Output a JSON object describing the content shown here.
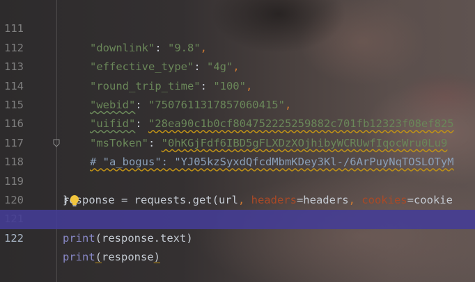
{
  "editor": {
    "lines": [
      {
        "num": "111",
        "key": "\"downlink\"",
        "colon": ": ",
        "value": "\"9.8\"",
        "comma": ","
      },
      {
        "num": "112",
        "key": "\"effective_type\"",
        "colon": ": ",
        "value": "\"4g\"",
        "comma": ","
      },
      {
        "num": "113",
        "key": "\"round_trip_time\"",
        "colon": ": ",
        "value": "\"100\"",
        "comma": ","
      },
      {
        "num": "114",
        "key": "\"webid\"",
        "colon": ": ",
        "value": "\"7507611317857060415\"",
        "comma": ","
      },
      {
        "num": "115",
        "key": "\"uifid\"",
        "colon": ": ",
        "value": "\"28ea90c1b0cf804752225259882c701fb12323f08ef825",
        "comma": ""
      },
      {
        "num": "116",
        "key": "\"msToken\"",
        "colon": ": ",
        "value": "\"0hKGjFdf6IBD5gFLXDzXOjhibyWCRUwfIqocWru0Lu9",
        "comma": ""
      },
      {
        "num": "117",
        "comment": "# \"a_bogus\": \"YJ05kzSyxdQfcdMbmKDey3Kl-/6ArPuyNqTOSLOTyM"
      },
      {
        "num": "118",
        "brace": "}"
      },
      {
        "num": "119",
        "p1": "response = requests.get(url",
        "c1": ", ",
        "p2": "headers",
        "p3": "=headers",
        "c2": ", ",
        "p4": "cookies",
        "p5": "=cookie"
      },
      {
        "num": "120"
      },
      {
        "num": "121",
        "fn": "print",
        "args": "(response.text)"
      },
      {
        "num": "122",
        "fn": "print",
        "open": "(",
        "arg": "response",
        "close": ")"
      }
    ]
  },
  "colors": {
    "string": "#6a8759",
    "keyword": "#cc7832",
    "param": "#aa4926",
    "builtin": "#8888c6",
    "current_line": "#443c96",
    "line_number": "#7f7f7f"
  },
  "icons": [
    "fold-end-icon",
    "lightbulb-icon"
  ]
}
